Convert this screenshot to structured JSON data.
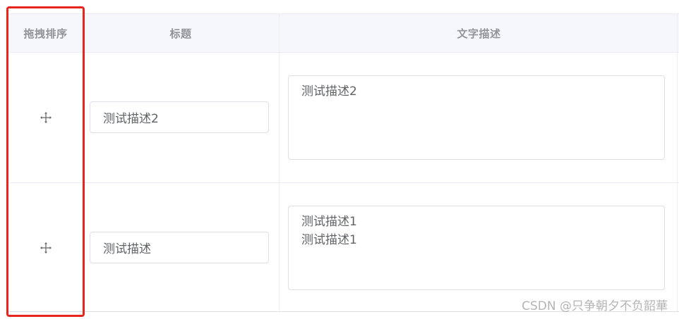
{
  "table": {
    "headers": {
      "drag": "拖拽排序",
      "title": "标题",
      "description": "文字描述"
    },
    "rows": [
      {
        "drag_icon": "move-icon",
        "title": "测试描述2",
        "description": "测试描述2"
      },
      {
        "drag_icon": "move-icon",
        "title": "测试描述",
        "description": "测试描述1\n测试描述1"
      }
    ]
  },
  "colors": {
    "highlight_border": "#e8251c",
    "header_bg": "#f5f7fa",
    "header_text": "#909399",
    "border": "#dcdfe6",
    "text": "#606266"
  },
  "watermark": "CSDN @只争朝夕不负韶華"
}
